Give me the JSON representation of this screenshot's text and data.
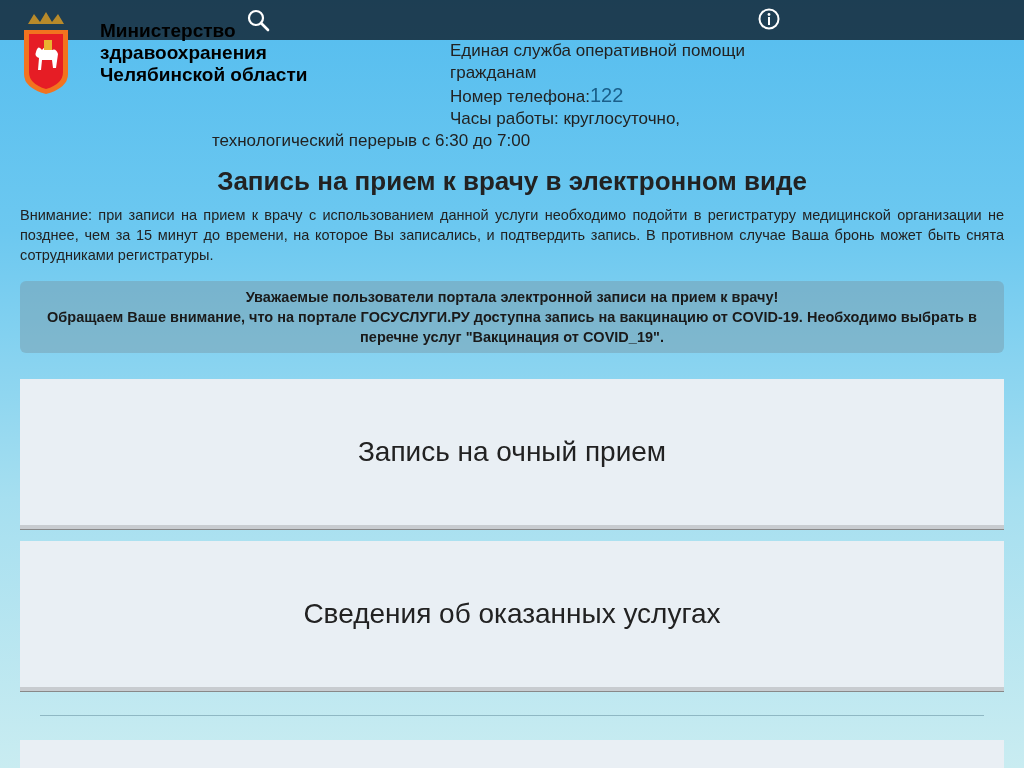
{
  "header": {
    "org_title": "Министерство здравоохранения Челябинской области",
    "service_name": "Единая служба оперативной помощи гражданам",
    "phone_label": "Номер телефона:",
    "phone_number": "122",
    "hours": [
      "Часы работы: круглосуточно,",
      "технологический перерыв с 6:30 до 7:00"
    ]
  },
  "page_title": "Запись на прием к врачу в электронном виде",
  "notice": "Внимание: при записи на прием к врачу с использованием данной услуги необходимо подойти в регистратуру медицинской организации не позднее, чем за 15 минут до времени, на которое Вы записались, и подтвердить запись. В противном случае Ваша бронь может быть снята сотрудниками регистратуры.",
  "alert": [
    "Уважаемые пользователи портала электронной записи на прием к врачу!",
    "Обращаем Ваше внимание, что на портале ГОСУСЛУГИ.РУ доступна запись на вакцинацию от COVID-19. Необходимо выбрать в перечне услуг \"Вакцинация от COVID_19\"."
  ],
  "menu_tiles": [
    "Запись на очный прием",
    "Сведения об оказанных услугах"
  ]
}
